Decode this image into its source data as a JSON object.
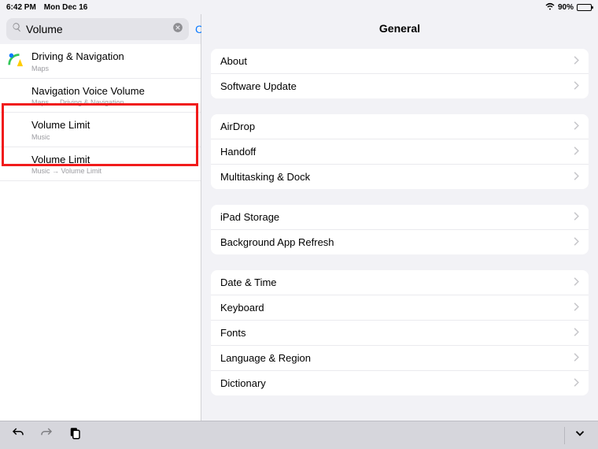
{
  "status": {
    "time": "6:42 PM",
    "date": "Mon Dec 16",
    "battery_pct": "90%"
  },
  "search": {
    "value": "Volume",
    "cancel_label": "Cancel"
  },
  "results": [
    {
      "title": "Driving & Navigation",
      "sub": "Maps",
      "icon": "maps"
    },
    {
      "title": "Navigation Voice Volume",
      "sub": "Maps → Driving & Navigation",
      "icon": ""
    },
    {
      "title": "Volume Limit",
      "sub": "Music",
      "icon": ""
    },
    {
      "title": "Volume Limit",
      "sub": "Music → Volume Limit",
      "icon": ""
    }
  ],
  "content": {
    "header": "General",
    "groups": [
      [
        "About",
        "Software Update"
      ],
      [
        "AirDrop",
        "Handoff",
        "Multitasking & Dock"
      ],
      [
        "iPad Storage",
        "Background App Refresh"
      ],
      [
        "Date & Time",
        "Keyboard",
        "Fonts",
        "Language & Region",
        "Dictionary"
      ]
    ]
  }
}
